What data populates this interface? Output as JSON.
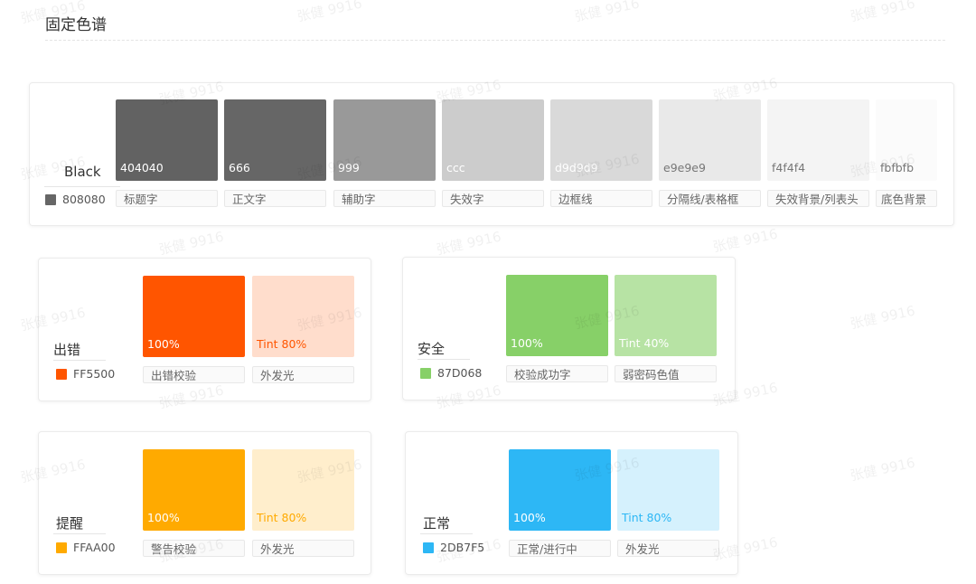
{
  "page": {
    "title": "固定色谱"
  },
  "watermark": {
    "text": "张健 9916"
  },
  "black": {
    "name": "Black",
    "hex": "808080",
    "dot_color": "#666666",
    "swatches": [
      {
        "hex": "404040",
        "color": "#626262",
        "text_color": "#ffffff",
        "usage": "标题字"
      },
      {
        "hex": "666",
        "color": "#666666",
        "text_color": "#ffffff",
        "usage": "正文字"
      },
      {
        "hex": "999",
        "color": "#999999",
        "text_color": "#ffffff",
        "usage": "辅助字"
      },
      {
        "hex": "ccc",
        "color": "#cccccc",
        "text_color": "#ffffff",
        "usage": "失效字"
      },
      {
        "hex": "d9d9d9",
        "color": "#d9d9d9",
        "text_color": "#ffffff",
        "usage": "边框线"
      },
      {
        "hex": "e9e9e9",
        "color": "#e9e9e9",
        "text_color": "#777777",
        "usage": "分隔线/表格框"
      },
      {
        "hex": "f4f4f4",
        "color": "#f4f4f4",
        "text_color": "#777777",
        "usage": "失效背景/列表头"
      },
      {
        "hex": "fbfbfb",
        "color": "#fbfbfb",
        "text_color": "#777777",
        "usage": "底色背景"
      }
    ]
  },
  "error": {
    "name": "出错",
    "hex": "FF5500",
    "dot_color": "#ff5500",
    "main": {
      "label": "100%",
      "color": "#ff5500",
      "text_color": "#ffffff",
      "usage": "出错校验"
    },
    "tint": {
      "label": "Tint 80%",
      "color": "#ffddcc",
      "text_color": "#ff5500",
      "usage": "外发光"
    }
  },
  "safe": {
    "name": "安全",
    "hex": "87D068",
    "dot_color": "#87d068",
    "main": {
      "label": "100%",
      "color": "#87d068",
      "text_color": "#ffffff",
      "usage": "校验成功字"
    },
    "tint": {
      "label": "Tint 40%",
      "color": "#b7e3a4",
      "text_color": "#ffffff",
      "usage": "弱密码色值"
    }
  },
  "warning": {
    "name": "提醒",
    "hex": "FFAA00",
    "dot_color": "#ffaa00",
    "main": {
      "label": "100%",
      "color": "#ffaa00",
      "text_color": "#ffffff",
      "usage": "警告校验"
    },
    "tint": {
      "label": "Tint 80%",
      "color": "#ffeecc",
      "text_color": "#ffaa00",
      "usage": "外发光"
    }
  },
  "normal": {
    "name": "正常",
    "hex": "2DB7F5",
    "dot_color": "#2db7f5",
    "main": {
      "label": "100%",
      "color": "#2db7f5",
      "text_color": "#ffffff",
      "usage": "正常/进行中"
    },
    "tint": {
      "label": "Tint 80%",
      "color": "#d5f1fd",
      "text_color": "#2db7f5",
      "usage": "外发光"
    }
  }
}
